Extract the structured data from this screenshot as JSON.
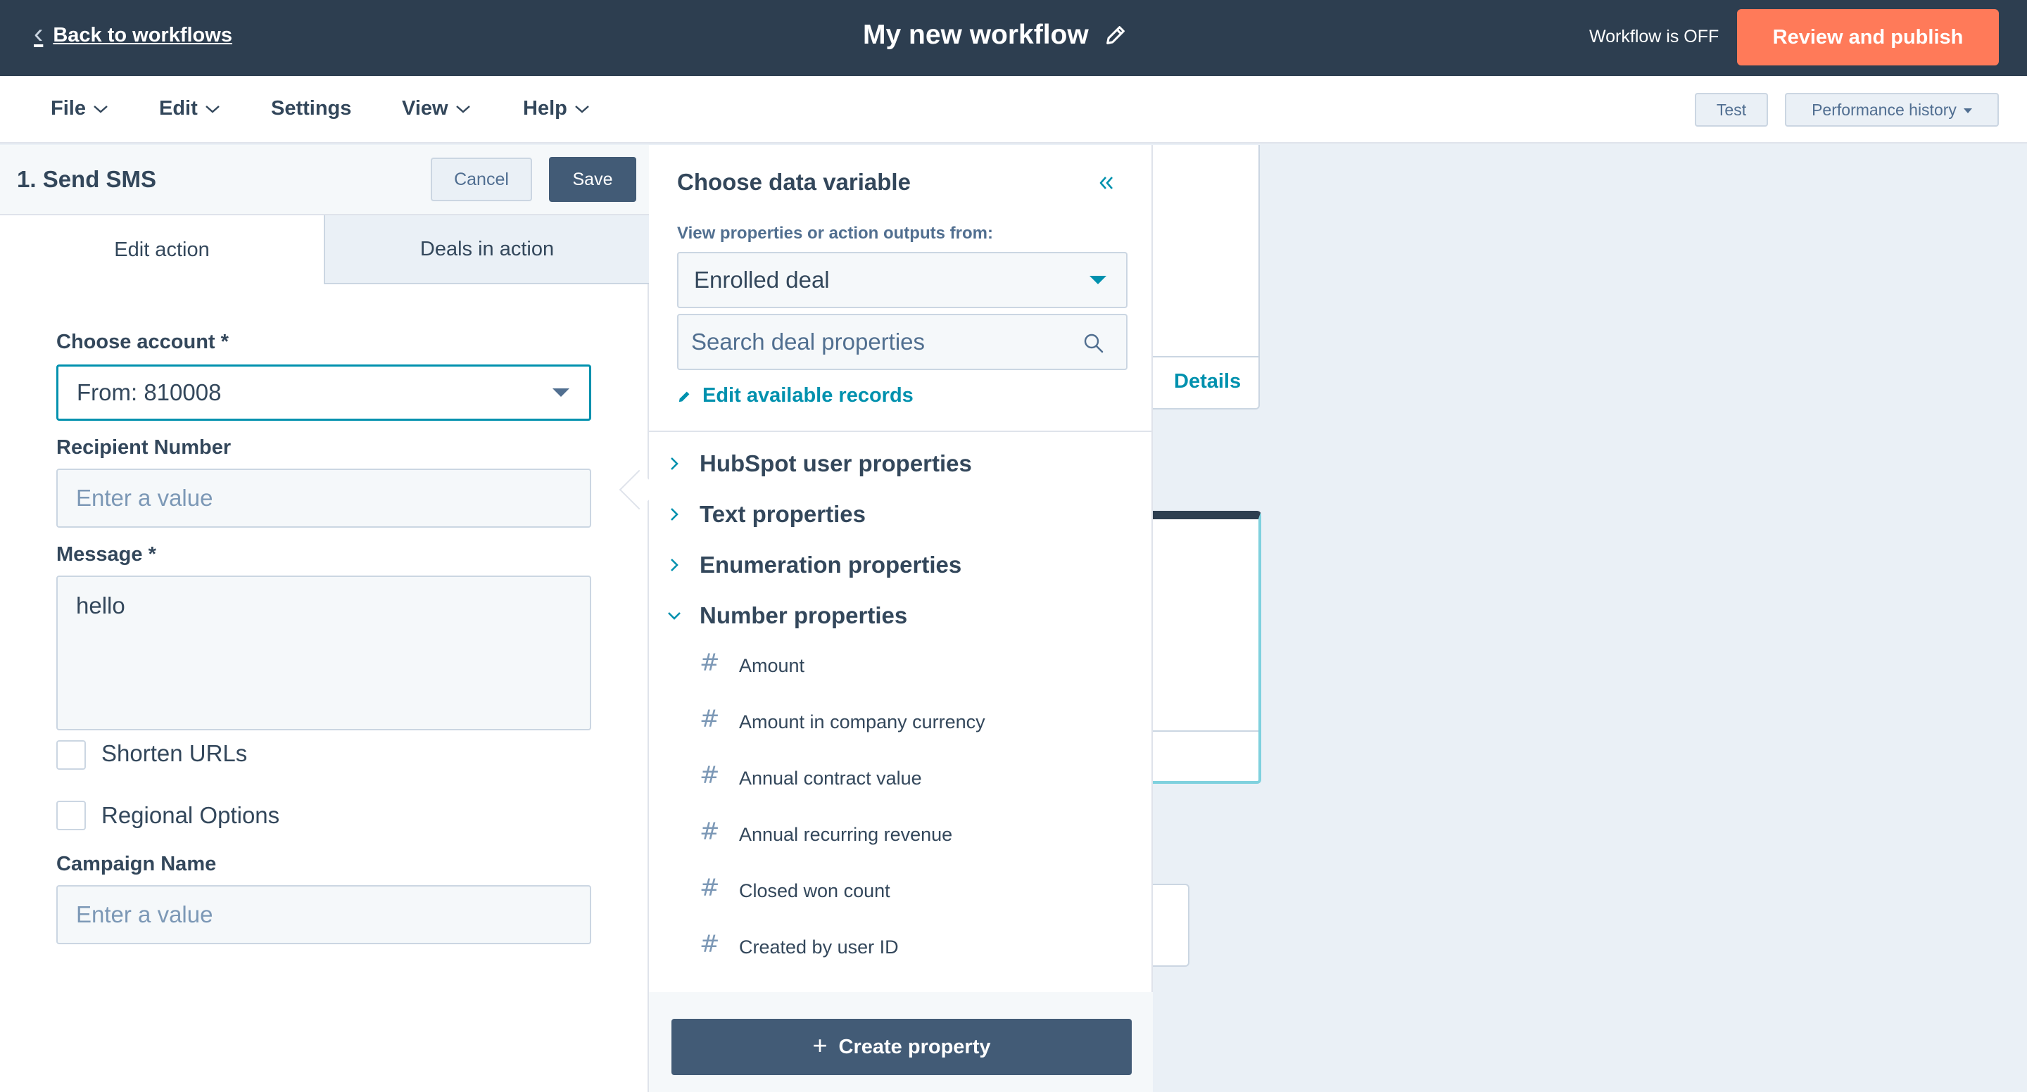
{
  "topbar": {
    "back_label": "Back to workflows",
    "workflow_title": "My new workflow",
    "status": "Workflow is OFF",
    "publish_label": "Review and publish"
  },
  "menubar": {
    "items": [
      {
        "label": "File"
      },
      {
        "label": "Edit"
      },
      {
        "label": "Settings"
      },
      {
        "label": "View"
      },
      {
        "label": "Help"
      }
    ],
    "test_label": "Test",
    "performance_label": "Performance history"
  },
  "canvas": {
    "details_label": "Details"
  },
  "action_panel": {
    "title": "1. Send SMS",
    "cancel_label": "Cancel",
    "save_label": "Save",
    "tabs": [
      {
        "label": "Edit action"
      },
      {
        "label": "Deals in action"
      }
    ],
    "choose_account_label": "Choose account *",
    "choose_account_value": "From: 810008",
    "recipient_label": "Recipient Number",
    "recipient_placeholder": "Enter a value",
    "message_label": "Message *",
    "message_value": "hello",
    "shorten_urls_label": "Shorten URLs",
    "regional_options_label": "Regional Options",
    "campaign_label": "Campaign Name",
    "campaign_placeholder": "Enter a value"
  },
  "data_variable": {
    "title": "Choose data variable",
    "source_label": "View properties or action outputs from:",
    "source_value": "Enrolled deal",
    "search_placeholder": "Search deal properties",
    "edit_records_label": "Edit available records",
    "groups": [
      {
        "label": "HubSpot user properties",
        "expanded": false
      },
      {
        "label": "Text properties",
        "expanded": false
      },
      {
        "label": "Enumeration properties",
        "expanded": false
      },
      {
        "label": "Number properties",
        "expanded": true
      }
    ],
    "number_properties": [
      {
        "label": "Amount"
      },
      {
        "label": "Amount in company currency"
      },
      {
        "label": "Annual contract value"
      },
      {
        "label": "Annual recurring revenue"
      },
      {
        "label": "Closed won count"
      },
      {
        "label": "Created by user ID"
      }
    ],
    "property_icon": "#",
    "create_label": "Create property"
  },
  "colors": {
    "topbar_bg": "#2d3e50",
    "publish_bg": "#ff7a59",
    "link": "#0091ae",
    "dark_button": "#425b76"
  }
}
